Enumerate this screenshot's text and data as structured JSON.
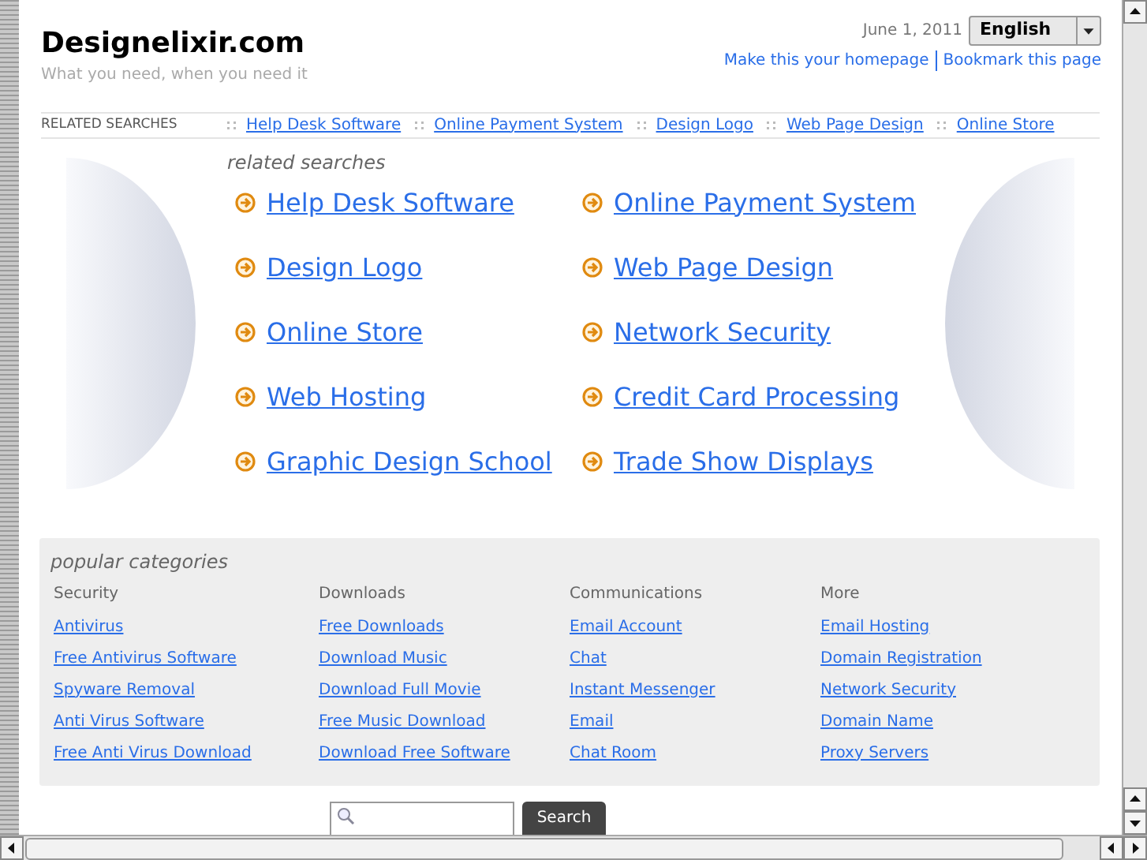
{
  "header": {
    "site_title": "Designelixir.com",
    "tagline": "What you need, when you need it",
    "date": "June 1, 2011",
    "language": "English",
    "links": [
      "Make this your homepage",
      "Bookmark this page"
    ]
  },
  "related_bar": {
    "label": "RELATED SEARCHES",
    "links": [
      "Help Desk Software",
      "Online Payment System",
      "Design Logo",
      "Web Page Design",
      "Online Store"
    ]
  },
  "related_searches": {
    "heading": "related searches",
    "links": [
      "Help Desk Software",
      "Online Payment System",
      "Design Logo",
      "Web Page Design",
      "Online Store",
      "Network Security",
      "Web Hosting",
      "Credit Card Processing",
      "Graphic Design School",
      "Trade Show Displays"
    ]
  },
  "popular_categories": {
    "heading": "popular categories",
    "columns": [
      {
        "title": "Security",
        "links": [
          "Antivirus",
          "Free Antivirus Software",
          "Spyware Removal",
          "Anti Virus Software",
          "Free Anti Virus Download"
        ]
      },
      {
        "title": "Downloads",
        "links": [
          "Free Downloads",
          "Download Music",
          "Download Full Movie",
          "Free Music Download",
          "Download Free Software"
        ]
      },
      {
        "title": "Communications",
        "links": [
          "Email Account",
          "Chat",
          "Instant Messenger",
          "Email",
          "Chat Room"
        ]
      },
      {
        "title": "More",
        "links": [
          "Email Hosting",
          "Domain Registration",
          "Network Security",
          "Domain Name",
          "Proxy Servers"
        ]
      }
    ]
  },
  "search": {
    "button": "Search"
  }
}
